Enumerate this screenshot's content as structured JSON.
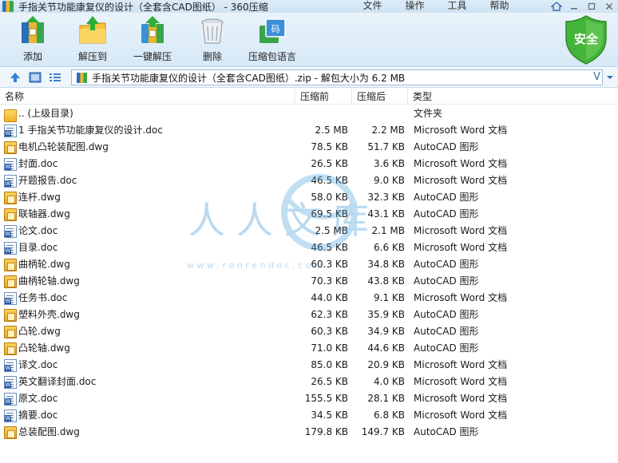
{
  "window": {
    "title": "手指关节功能康复仪的设计（全套含CAD图纸） - 360压缩",
    "menu": [
      "文件",
      "操作",
      "工具",
      "帮助"
    ]
  },
  "toolbar": {
    "add_label": "添加",
    "extract_label": "解压到",
    "one_click_label": "一键解压",
    "delete_label": "删除",
    "language_label": "压缩包语言",
    "safe_label": "安全"
  },
  "address": {
    "path": "手指关节功能康复仪的设计（全套含CAD图纸）.zip - 解包大小为 6.2 MB",
    "v_label": "V"
  },
  "columns": {
    "name": "名称",
    "packed": "压缩前",
    "unpacked": "压缩后",
    "type": "类型"
  },
  "watermark": {
    "text": "人人文库",
    "url": "w w w . r e n r e n d o c . c o m"
  },
  "files": [
    {
      "name": ".. (上级目录)",
      "packed": "",
      "unpacked": "",
      "type": "文件夹",
      "icon": "folder-icon"
    },
    {
      "name": "1 手指关节功能康复仪的设计.doc",
      "packed": "2.5 MB",
      "unpacked": "2.2 MB",
      "type": "Microsoft Word 文档",
      "icon": "word-doc-icon"
    },
    {
      "name": "电机凸轮装配图.dwg",
      "packed": "78.5 KB",
      "unpacked": "51.7 KB",
      "type": "AutoCAD 图形",
      "icon": "dwg-file-icon"
    },
    {
      "name": "封面.doc",
      "packed": "26.5 KB",
      "unpacked": "3.6 KB",
      "type": "Microsoft Word 文档",
      "icon": "word-doc-icon"
    },
    {
      "name": "开题报告.doc",
      "packed": "46.5 KB",
      "unpacked": "9.0 KB",
      "type": "Microsoft Word 文档",
      "icon": "word-doc-icon"
    },
    {
      "name": "连杆.dwg",
      "packed": "58.0 KB",
      "unpacked": "32.3 KB",
      "type": "AutoCAD 图形",
      "icon": "dwg-file-icon"
    },
    {
      "name": "联轴器.dwg",
      "packed": "69.5 KB",
      "unpacked": "43.1 KB",
      "type": "AutoCAD 图形",
      "icon": "dwg-file-icon"
    },
    {
      "name": "论文.doc",
      "packed": "2.5 MB",
      "unpacked": "2.1 MB",
      "type": "Microsoft Word 文档",
      "icon": "word-doc-icon"
    },
    {
      "name": "目录.doc",
      "packed": "46.5 KB",
      "unpacked": "6.6 KB",
      "type": "Microsoft Word 文档",
      "icon": "word-doc-icon"
    },
    {
      "name": "曲柄轮.dwg",
      "packed": "60.3 KB",
      "unpacked": "34.8 KB",
      "type": "AutoCAD 图形",
      "icon": "dwg-file-icon"
    },
    {
      "name": "曲柄轮轴.dwg",
      "packed": "70.3 KB",
      "unpacked": "43.8 KB",
      "type": "AutoCAD 图形",
      "icon": "dwg-file-icon"
    },
    {
      "name": "任务书.doc",
      "packed": "44.0 KB",
      "unpacked": "9.1 KB",
      "type": "Microsoft Word 文档",
      "icon": "word-doc-icon"
    },
    {
      "name": "塑料外壳.dwg",
      "packed": "62.3 KB",
      "unpacked": "35.9 KB",
      "type": "AutoCAD 图形",
      "icon": "dwg-file-icon"
    },
    {
      "name": "凸轮.dwg",
      "packed": "60.3 KB",
      "unpacked": "34.9 KB",
      "type": "AutoCAD 图形",
      "icon": "dwg-file-icon"
    },
    {
      "name": "凸轮轴.dwg",
      "packed": "71.0 KB",
      "unpacked": "44.6 KB",
      "type": "AutoCAD 图形",
      "icon": "dwg-file-icon"
    },
    {
      "name": "译文.doc",
      "packed": "85.0 KB",
      "unpacked": "20.9 KB",
      "type": "Microsoft Word 文档",
      "icon": "word-doc-icon"
    },
    {
      "name": "英文翻译封面.doc",
      "packed": "26.5 KB",
      "unpacked": "4.0 KB",
      "type": "Microsoft Word 文档",
      "icon": "word-doc-icon"
    },
    {
      "name": "原文.doc",
      "packed": "155.5 KB",
      "unpacked": "28.1 KB",
      "type": "Microsoft Word 文档",
      "icon": "word-doc-icon"
    },
    {
      "name": "摘要.doc",
      "packed": "34.5 KB",
      "unpacked": "6.8 KB",
      "type": "Microsoft Word 文档",
      "icon": "word-doc-icon"
    },
    {
      "name": "总装配图.dwg",
      "packed": "179.8 KB",
      "unpacked": "149.7 KB",
      "type": "AutoCAD 图形",
      "icon": "dwg-file-icon"
    }
  ]
}
